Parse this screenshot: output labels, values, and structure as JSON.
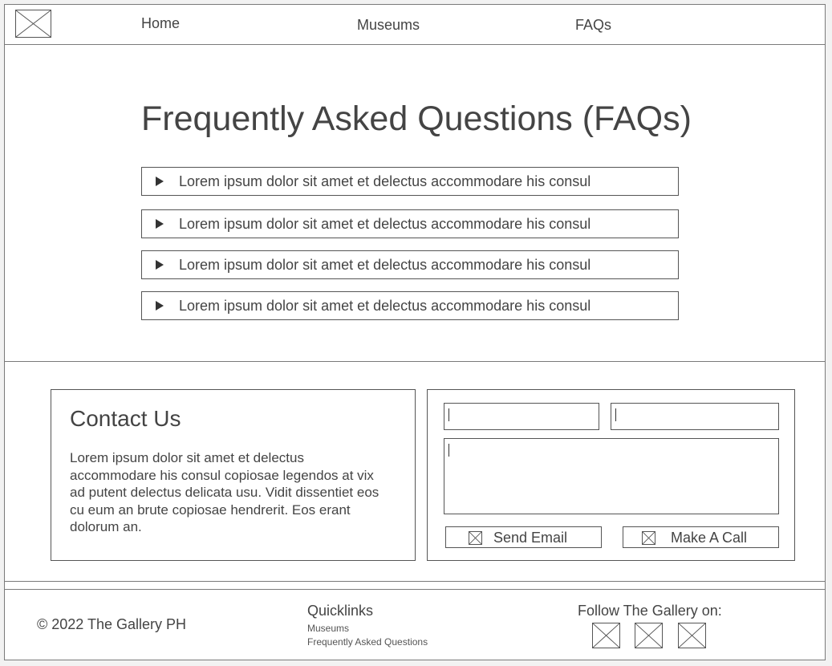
{
  "nav": {
    "logo_icon": "placeholder-image-icon",
    "items": [
      {
        "label": "Home"
      },
      {
        "label": "Museums"
      },
      {
        "label": "FAQs"
      }
    ]
  },
  "faq": {
    "title": "Frequently Asked Questions (FAQs)",
    "expand_icon": "triangle-right-icon",
    "items": [
      {
        "question": "Lorem ipsum dolor sit amet et delectus accommodare his consul"
      },
      {
        "question": "Lorem ipsum dolor sit amet et delectus accommodare his consul"
      },
      {
        "question": "Lorem ipsum dolor sit amet et delectus accommodare his consul"
      },
      {
        "question": "Lorem ipsum dolor sit amet et delectus accommodare his consul"
      }
    ]
  },
  "contact": {
    "title": "Contact Us",
    "body": "Lorem ipsum dolor sit amet et delectus accommodare his consul copiosae legendos at vix ad putent delectus delicata usu. Vidit dissentiet eos cu eum an brute copiosae hendrerit. Eos erant dolorum an."
  },
  "form": {
    "name_value": "",
    "email_value": "",
    "message_value": "",
    "send_label": "Send Email",
    "call_label": "Make A Call",
    "button_icon": "placeholder-image-icon"
  },
  "footer": {
    "copyright": "© 2022 The Gallery PH",
    "quicklinks_title": "Quicklinks",
    "quicklinks": [
      {
        "label": "Museums"
      },
      {
        "label": "Frequently Asked Questions"
      }
    ],
    "follow_label": "Follow The Gallery on:",
    "social_icons": [
      "placeholder-image-icon",
      "placeholder-image-icon",
      "placeholder-image-icon"
    ]
  },
  "colors": {
    "border": "#555555",
    "text": "#444444",
    "background": "#ffffff"
  }
}
